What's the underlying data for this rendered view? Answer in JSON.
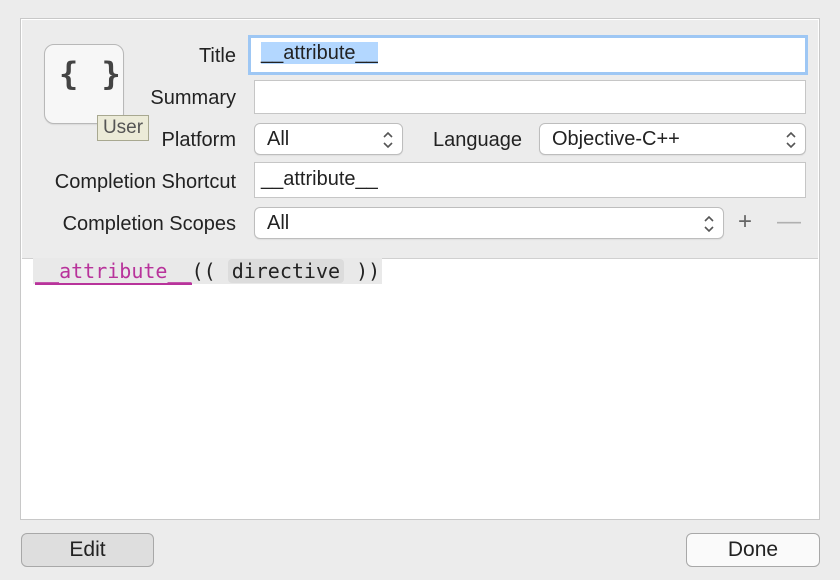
{
  "form": {
    "icon_braces": "{ }",
    "icon_tag": "User",
    "title_label": "Title",
    "title_value": "__attribute__",
    "summary_label": "Summary",
    "summary_value": "",
    "platform_label": "Platform",
    "platform_value": "All",
    "language_label": "Language",
    "language_value": "Objective-C++",
    "shortcut_label": "Completion Shortcut",
    "shortcut_value": "__attribute__",
    "scopes_label": "Completion Scopes",
    "scopes_value": "All",
    "add_symbol": "+",
    "remove_symbol": "—"
  },
  "code": {
    "keyword": "__attribute__",
    "open": "((",
    "placeholder": "directive",
    "close": "))"
  },
  "buttons": {
    "edit": "Edit",
    "done": "Done"
  },
  "colors": {
    "keyword": "#b8339b",
    "focus_ring": "#9ec7f4",
    "selection": "#b3d7ff"
  }
}
